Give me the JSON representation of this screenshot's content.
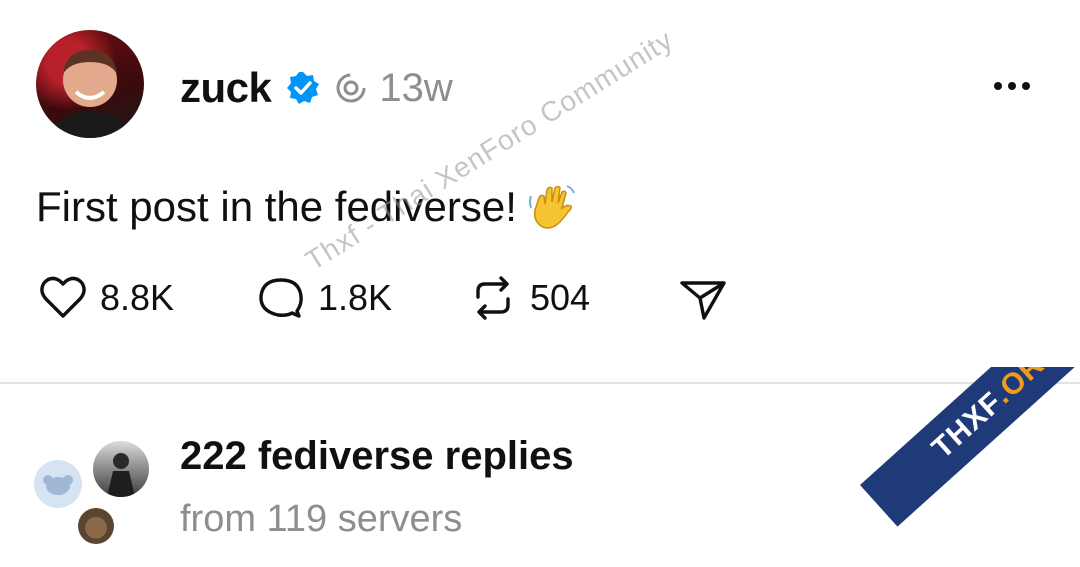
{
  "post": {
    "author": {
      "username": "zuck",
      "verified": true,
      "avatar_icon": "profile-photo"
    },
    "time": "13w",
    "text": "First post in the fediverse!",
    "emoji": "waving-hand-emoji",
    "stats": {
      "likes": "8.8K",
      "replies": "1.8K",
      "reposts": "504"
    }
  },
  "fediverse": {
    "title": "222 fediverse replies",
    "subtitle": "from 119 servers"
  },
  "watermark": {
    "text": "Thxf - Thai XenForo Community"
  },
  "ribbon": {
    "brand": "THXF",
    "tld": ".ORG"
  },
  "colors": {
    "verified": "#0095f6",
    "muted": "#8e8e8e",
    "ribbon": "#1e3a78",
    "ribbon_accent": "#f39a1e"
  }
}
